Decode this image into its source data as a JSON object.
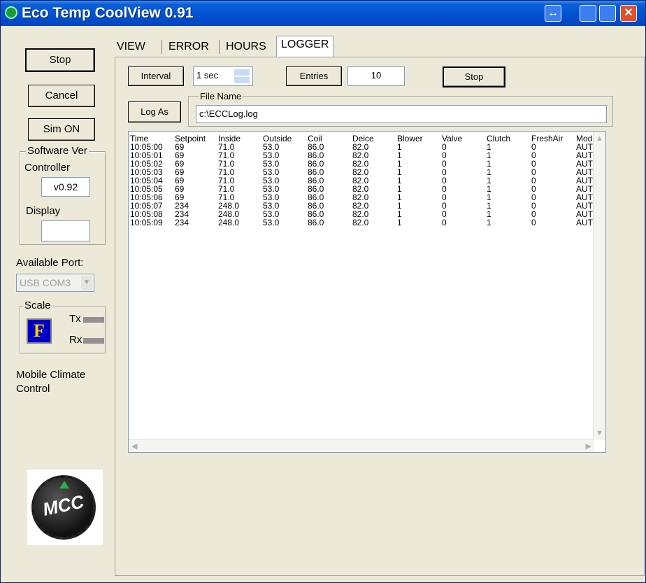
{
  "window": {
    "title": "Eco Temp CoolView 0.91"
  },
  "sidebar": {
    "stop_label": "Stop",
    "cancel_label": "Cancel",
    "sim_label": "Sim ON",
    "software_ver_title": "Software Ver",
    "controller_label": "Controller",
    "controller_version": "v0.92",
    "display_label": "Display",
    "display_version": "",
    "available_port_label": "Available Port:",
    "port_value": "USB COM3",
    "scale_title": "Scale",
    "scale_unit": "F",
    "tx_label": "Tx",
    "rx_label": "Rx",
    "company_line1": "Mobile Climate",
    "company_line2": "Control",
    "logo_text": "MCC"
  },
  "tabs": [
    {
      "label": "VIEW"
    },
    {
      "label": "ERROR"
    },
    {
      "label": "HOURS"
    },
    {
      "label": "LOGGER"
    }
  ],
  "logger": {
    "interval_label": "Interval",
    "interval_value": "1 sec",
    "entries_label": "Entries",
    "entries_value": "10",
    "stop_label": "Stop",
    "log_as_label": "Log As",
    "file_name_title": "File Name",
    "file_name_value": "c:\\ECCLog.log"
  },
  "log_table": {
    "columns": [
      "Time",
      "Setpoint",
      "Inside",
      "Outside",
      "Coil",
      "Deice",
      "Blower",
      "Valve",
      "Clutch",
      "FreshAir",
      "Mode"
    ],
    "rows": [
      [
        "10:05:00",
        "69",
        "71.0",
        "53.0",
        "86.0",
        "82.0",
        "1",
        "0",
        "1",
        "0",
        "AUTO"
      ],
      [
        "10:05:01",
        "69",
        "71.0",
        "53.0",
        "86.0",
        "82.0",
        "1",
        "0",
        "1",
        "0",
        "AUTO"
      ],
      [
        "10:05:02",
        "69",
        "71.0",
        "53.0",
        "86.0",
        "82.0",
        "1",
        "0",
        "1",
        "0",
        "AUTO"
      ],
      [
        "10:05:03",
        "69",
        "71.0",
        "53.0",
        "86.0",
        "82.0",
        "1",
        "0",
        "1",
        "0",
        "AUTO"
      ],
      [
        "10:05:04",
        "69",
        "71.0",
        "53.0",
        "86.0",
        "82.0",
        "1",
        "0",
        "1",
        "0",
        "AUTO"
      ],
      [
        "10:05:05",
        "69",
        "71.0",
        "53.0",
        "86.0",
        "82.0",
        "1",
        "0",
        "1",
        "0",
        "AUTO"
      ],
      [
        "10:05:06",
        "69",
        "71.0",
        "53.0",
        "86.0",
        "82.0",
        "1",
        "0",
        "1",
        "0",
        "AUTO"
      ],
      [
        "10:05:07",
        "234",
        "248.0",
        "53.0",
        "86.0",
        "82.0",
        "1",
        "0",
        "1",
        "0",
        "AUTO"
      ],
      [
        "10:05:08",
        "234",
        "248.0",
        "53.0",
        "86.0",
        "82.0",
        "1",
        "0",
        "1",
        "0",
        "AUTO"
      ],
      [
        "10:05:09",
        "234",
        "248.0",
        "53.0",
        "86.0",
        "82.0",
        "1",
        "0",
        "1",
        "0",
        "AUTO"
      ]
    ]
  },
  "colors": {
    "titlebar": "#0050d0",
    "window_bg": "#ece9d8",
    "scale_icon_bg": "#0000c8",
    "scale_icon_fg": "#ffd400",
    "logo_accent": "#2bb04a"
  }
}
